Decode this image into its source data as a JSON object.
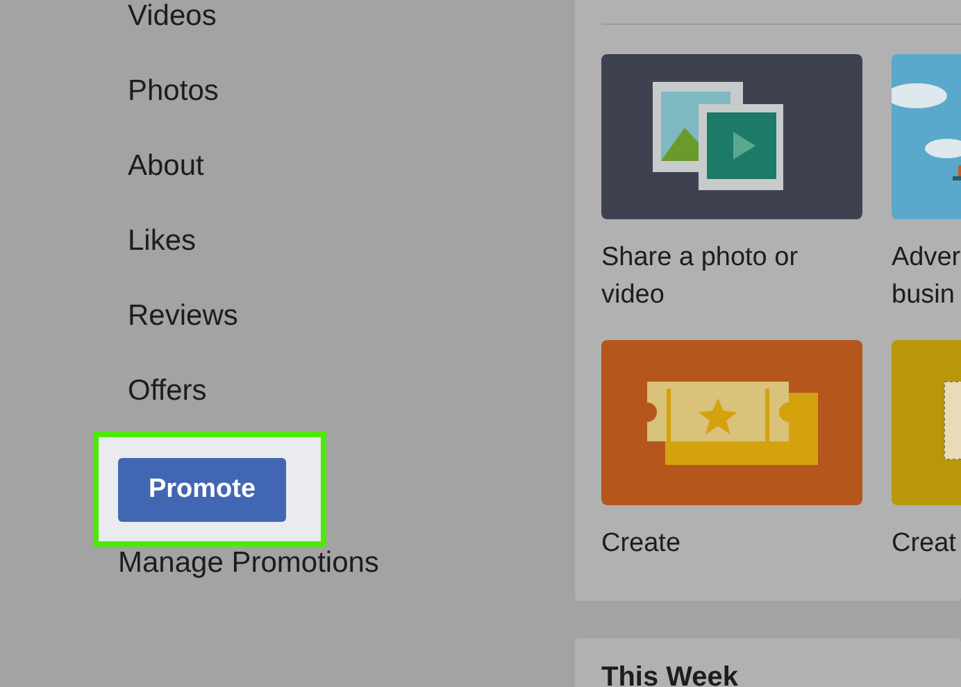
{
  "sidebar": {
    "items": [
      {
        "label": "Videos"
      },
      {
        "label": "Photos"
      },
      {
        "label": "About"
      },
      {
        "label": "Likes"
      },
      {
        "label": "Reviews"
      },
      {
        "label": "Offers"
      }
    ],
    "promote_button": {
      "label": "Promote",
      "highlighted": true
    },
    "manage_link": "Manage Promotions"
  },
  "actions": {
    "tiles": [
      {
        "kind": "photo",
        "lines": [
          "Share a photo or",
          "video"
        ]
      },
      {
        "kind": "advertise",
        "lines": [
          "Adver",
          "busin"
        ]
      },
      {
        "kind": "ticket",
        "lines": [
          "Create"
        ]
      },
      {
        "kind": "offer",
        "lines": [
          "Creat"
        ]
      }
    ]
  },
  "next_card": {
    "title": "This Week"
  }
}
